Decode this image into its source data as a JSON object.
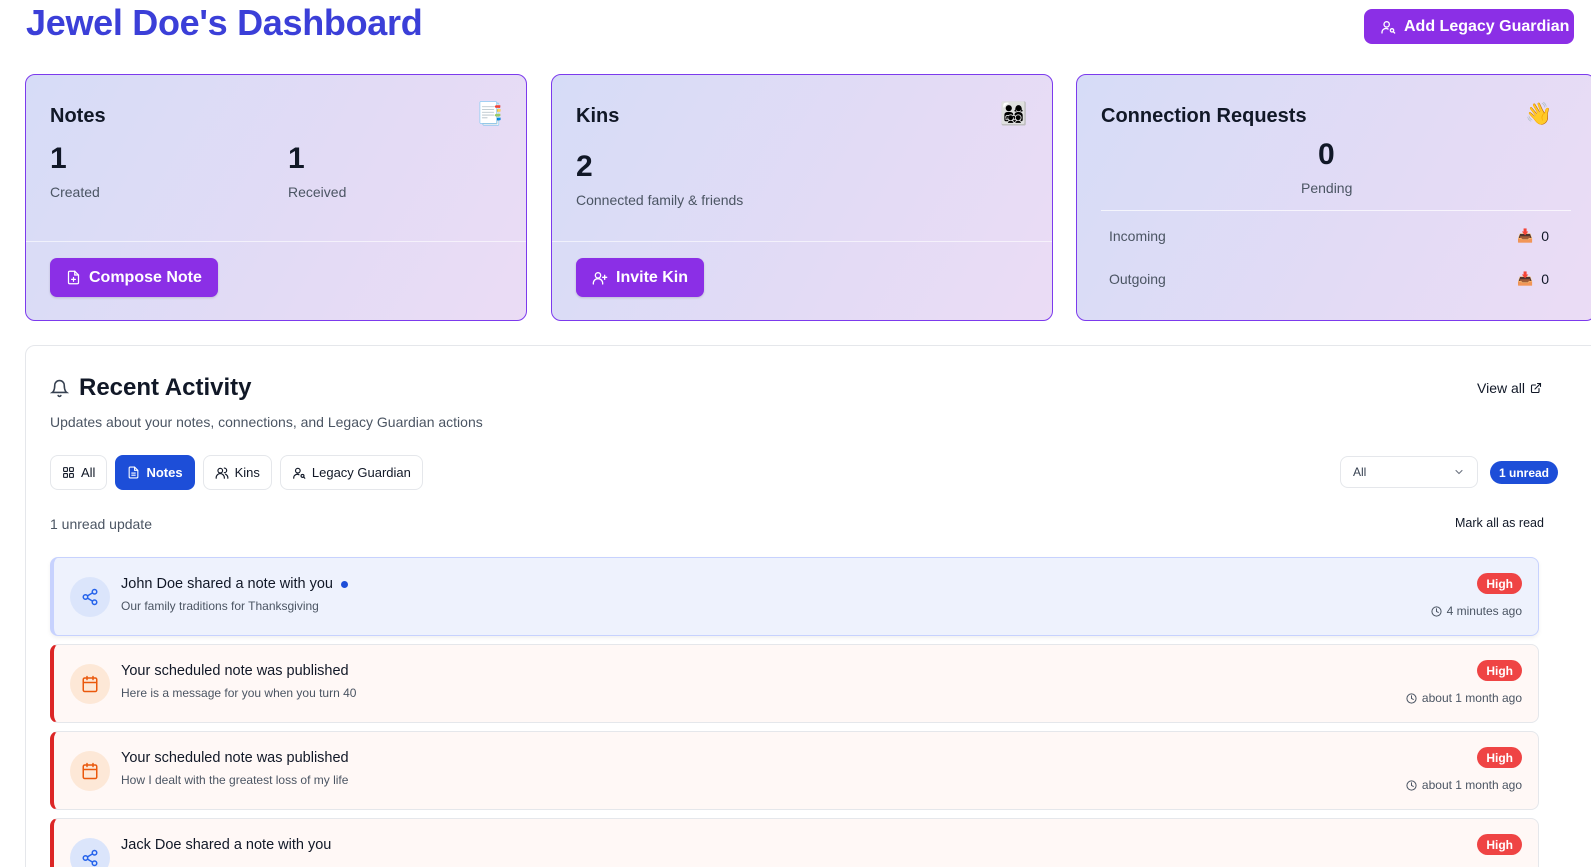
{
  "header": {
    "title": "Jewel Doe's Dashboard",
    "add_guardian_label": "Add Legacy Guardian"
  },
  "cards": {
    "notes": {
      "title": "Notes",
      "emoji": "📑",
      "created_count": "1",
      "created_label": "Created",
      "received_count": "1",
      "received_label": "Received",
      "button_label": "Compose Note"
    },
    "kins": {
      "title": "Kins",
      "emoji": "👨‍👩‍👧‍👦",
      "count": "2",
      "count_label": "Connected family & friends",
      "button_label": "Invite Kin"
    },
    "connections": {
      "title": "Connection Requests",
      "emoji": "👋",
      "pending_count": "0",
      "pending_label": "Pending",
      "incoming_label": "Incoming",
      "incoming_count": "0",
      "outgoing_label": "Outgoing",
      "outgoing_count": "0",
      "row_emoji": "📥"
    }
  },
  "activity": {
    "title": "Recent Activity",
    "subtitle": "Updates about your notes, connections, and Legacy Guardian actions",
    "view_all_label": "View all",
    "tabs": [
      {
        "label": "All",
        "icon": "grid-icon",
        "active": false
      },
      {
        "label": "Notes",
        "icon": "document-icon",
        "active": true
      },
      {
        "label": "Kins",
        "icon": "users-icon",
        "active": false
      },
      {
        "label": "Legacy Guardian",
        "icon": "user-key-icon",
        "active": false
      }
    ],
    "filter_value": "All",
    "unread_pill": "1 unread",
    "unread_summary": "1 unread update",
    "mark_all_read_label": "Mark all as read",
    "items": [
      {
        "title": "John Doe shared a note with you",
        "description": "Our family traditions for Thanksgiving",
        "priority": "High",
        "time": "4 minutes ago",
        "icon": "share-icon",
        "unread": true
      },
      {
        "title": "Your scheduled note was published",
        "description": "Here is a message for you when you turn 40",
        "priority": "High",
        "time": "about 1 month ago",
        "icon": "calendar-icon",
        "unread": false
      },
      {
        "title": "Your scheduled note was published",
        "description": "How I dealt with the greatest loss of my life",
        "priority": "High",
        "time": "about 1 month ago",
        "icon": "calendar-icon",
        "unread": false
      },
      {
        "title": "Jack Doe shared a note with you",
        "description": "",
        "priority": "High",
        "time": "",
        "icon": "share-icon",
        "unread": false
      }
    ]
  },
  "colors": {
    "title_blue": "#3b3fd8",
    "primary_purple": "#8b2fe6",
    "active_blue": "#1d4ed8",
    "high_red": "#ef4444"
  }
}
